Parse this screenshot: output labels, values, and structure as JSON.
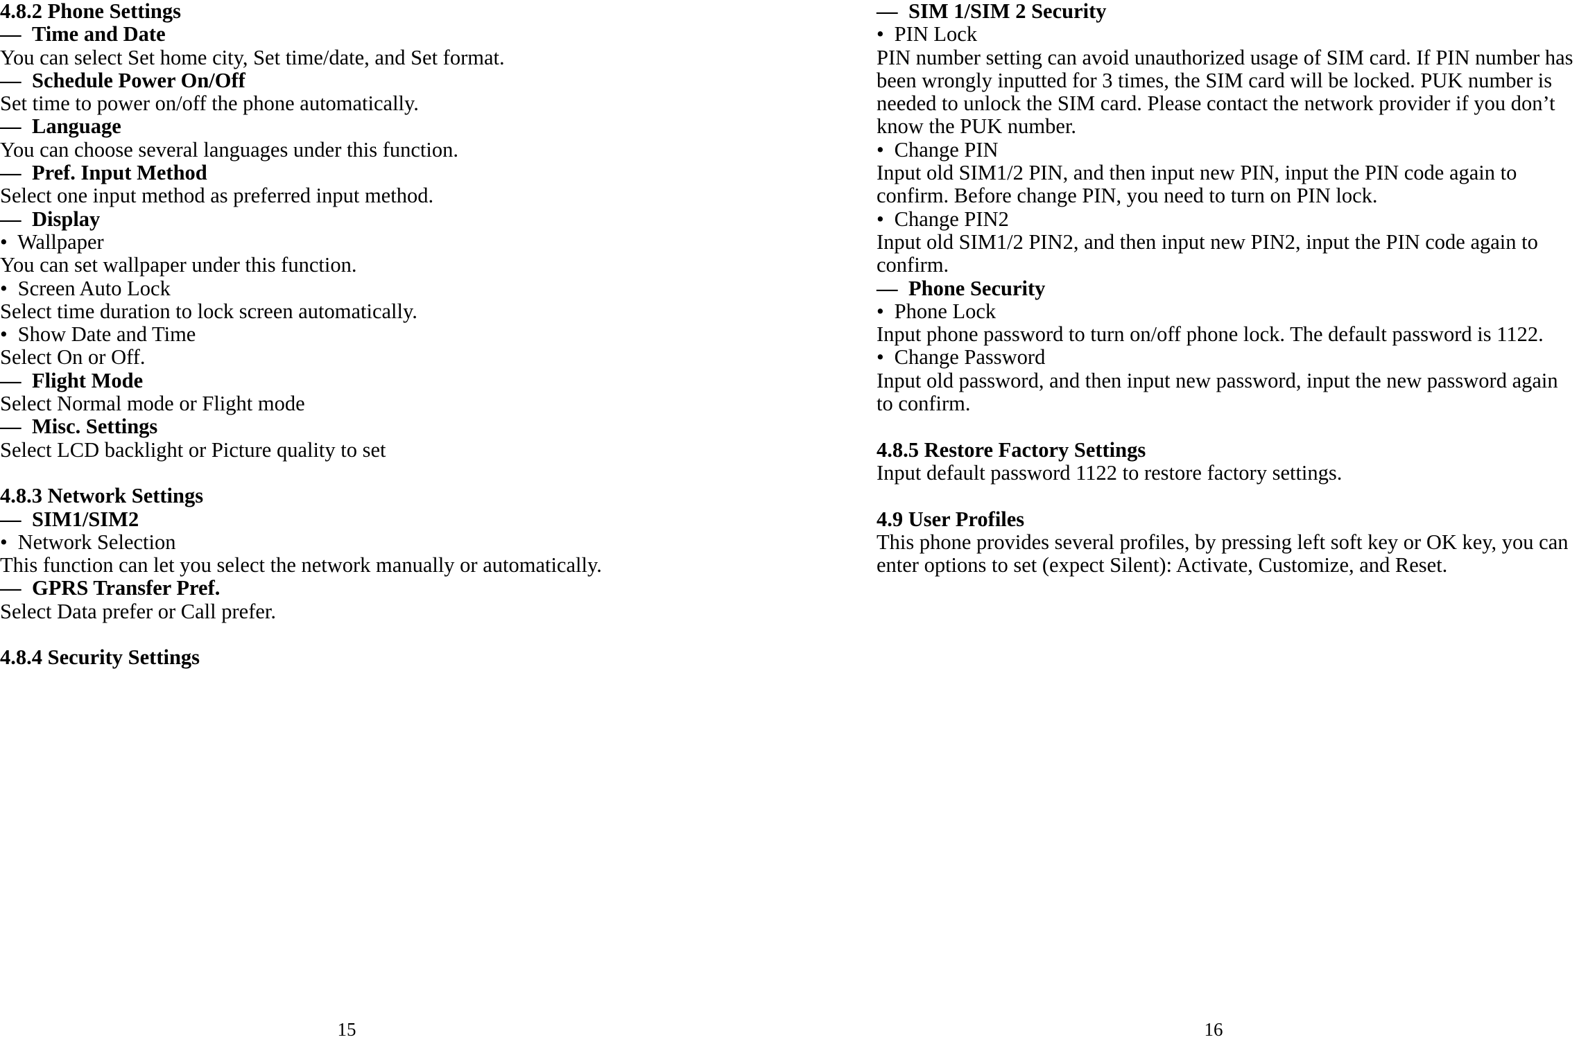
{
  "document": {
    "type": "phone-user-manual-spread",
    "background_color": "#ffffff",
    "text_color": "#000000",
    "dash_marker": "—",
    "bullet_marker": "•"
  },
  "left_page": {
    "page_number": "15",
    "blocks": [
      {
        "kind": "section",
        "text": "4.8.2 Phone Settings"
      },
      {
        "kind": "sub",
        "text": "Time and Date"
      },
      {
        "kind": "para",
        "text": "You can select Set home city, Set time/date, and Set format."
      },
      {
        "kind": "sub",
        "text": "Schedule Power On/Off"
      },
      {
        "kind": "para",
        "text": "Set time to power on/off the phone automatically."
      },
      {
        "kind": "sub",
        "text": "Language"
      },
      {
        "kind": "para",
        "text": "You can choose several languages under this function."
      },
      {
        "kind": "sub",
        "text": "Pref. Input Method"
      },
      {
        "kind": "para",
        "text": "Select one input method as preferred input method."
      },
      {
        "kind": "sub",
        "text": "Display"
      },
      {
        "kind": "bullet",
        "text": "Wallpaper"
      },
      {
        "kind": "para",
        "text": "You can set wallpaper under this function."
      },
      {
        "kind": "bullet",
        "text": "Screen Auto Lock"
      },
      {
        "kind": "para",
        "text": "Select time duration to lock screen automatically."
      },
      {
        "kind": "bullet",
        "text": "Show Date and Time"
      },
      {
        "kind": "para",
        "text": "Select On or Off."
      },
      {
        "kind": "sub",
        "text": "Flight Mode"
      },
      {
        "kind": "para",
        "text": "Select Normal mode or Flight mode"
      },
      {
        "kind": "sub",
        "text": "Misc. Settings"
      },
      {
        "kind": "para",
        "text": "Select LCD backlight or Picture quality to set"
      },
      {
        "kind": "blank",
        "text": ""
      },
      {
        "kind": "section",
        "text": "4.8.3 Network Settings"
      },
      {
        "kind": "sub",
        "text": "SIM1/SIM2"
      },
      {
        "kind": "bullet",
        "text": "Network Selection"
      },
      {
        "kind": "para",
        "text": "This function can let you select the network manually or automatically."
      },
      {
        "kind": "sub",
        "text": "GPRS Transfer Pref."
      },
      {
        "kind": "para",
        "text": "Select Data prefer or Call prefer."
      },
      {
        "kind": "blank",
        "text": ""
      },
      {
        "kind": "section",
        "text": "4.8.4 Security Settings"
      }
    ]
  },
  "right_page": {
    "page_number": "16",
    "blocks": [
      {
        "kind": "sub",
        "text": "SIM 1/SIM 2 Security"
      },
      {
        "kind": "bullet",
        "text": "PIN Lock"
      },
      {
        "kind": "para",
        "text": "PIN number setting can avoid unauthorized usage of SIM card. If PIN number has been wrongly inputted for 3 times, the SIM card will be locked. PUK number is needed to unlock the SIM card. Please contact the network provider if you don’t know the PUK number."
      },
      {
        "kind": "bullet",
        "text": "Change PIN"
      },
      {
        "kind": "para",
        "text": "Input old SIM1/2 PIN, and then input new PIN, input the PIN code again to confirm. Before change PIN, you need to turn on PIN lock."
      },
      {
        "kind": "bullet",
        "text": "Change PIN2"
      },
      {
        "kind": "para",
        "text": "Input old SIM1/2 PIN2, and then input new PIN2, input the PIN code again to confirm."
      },
      {
        "kind": "sub",
        "text": "Phone Security"
      },
      {
        "kind": "bullet",
        "text": "Phone Lock"
      },
      {
        "kind": "para",
        "text": "Input phone password to turn on/off phone lock. The default password is 1122."
      },
      {
        "kind": "bullet",
        "text": "Change Password"
      },
      {
        "kind": "para",
        "text": "Input old password, and then input new password, input the new password again to confirm."
      },
      {
        "kind": "blank",
        "text": ""
      },
      {
        "kind": "section",
        "text": "4.8.5 Restore Factory Settings"
      },
      {
        "kind": "para",
        "text": "Input default password 1122 to restore factory settings."
      },
      {
        "kind": "blank",
        "text": ""
      },
      {
        "kind": "section",
        "text": "4.9 User Profiles"
      },
      {
        "kind": "para",
        "text": "This phone provides several profiles, by pressing left soft key or OK key, you can enter options to set (expect Silent): Activate, Customize, and Reset."
      }
    ]
  }
}
